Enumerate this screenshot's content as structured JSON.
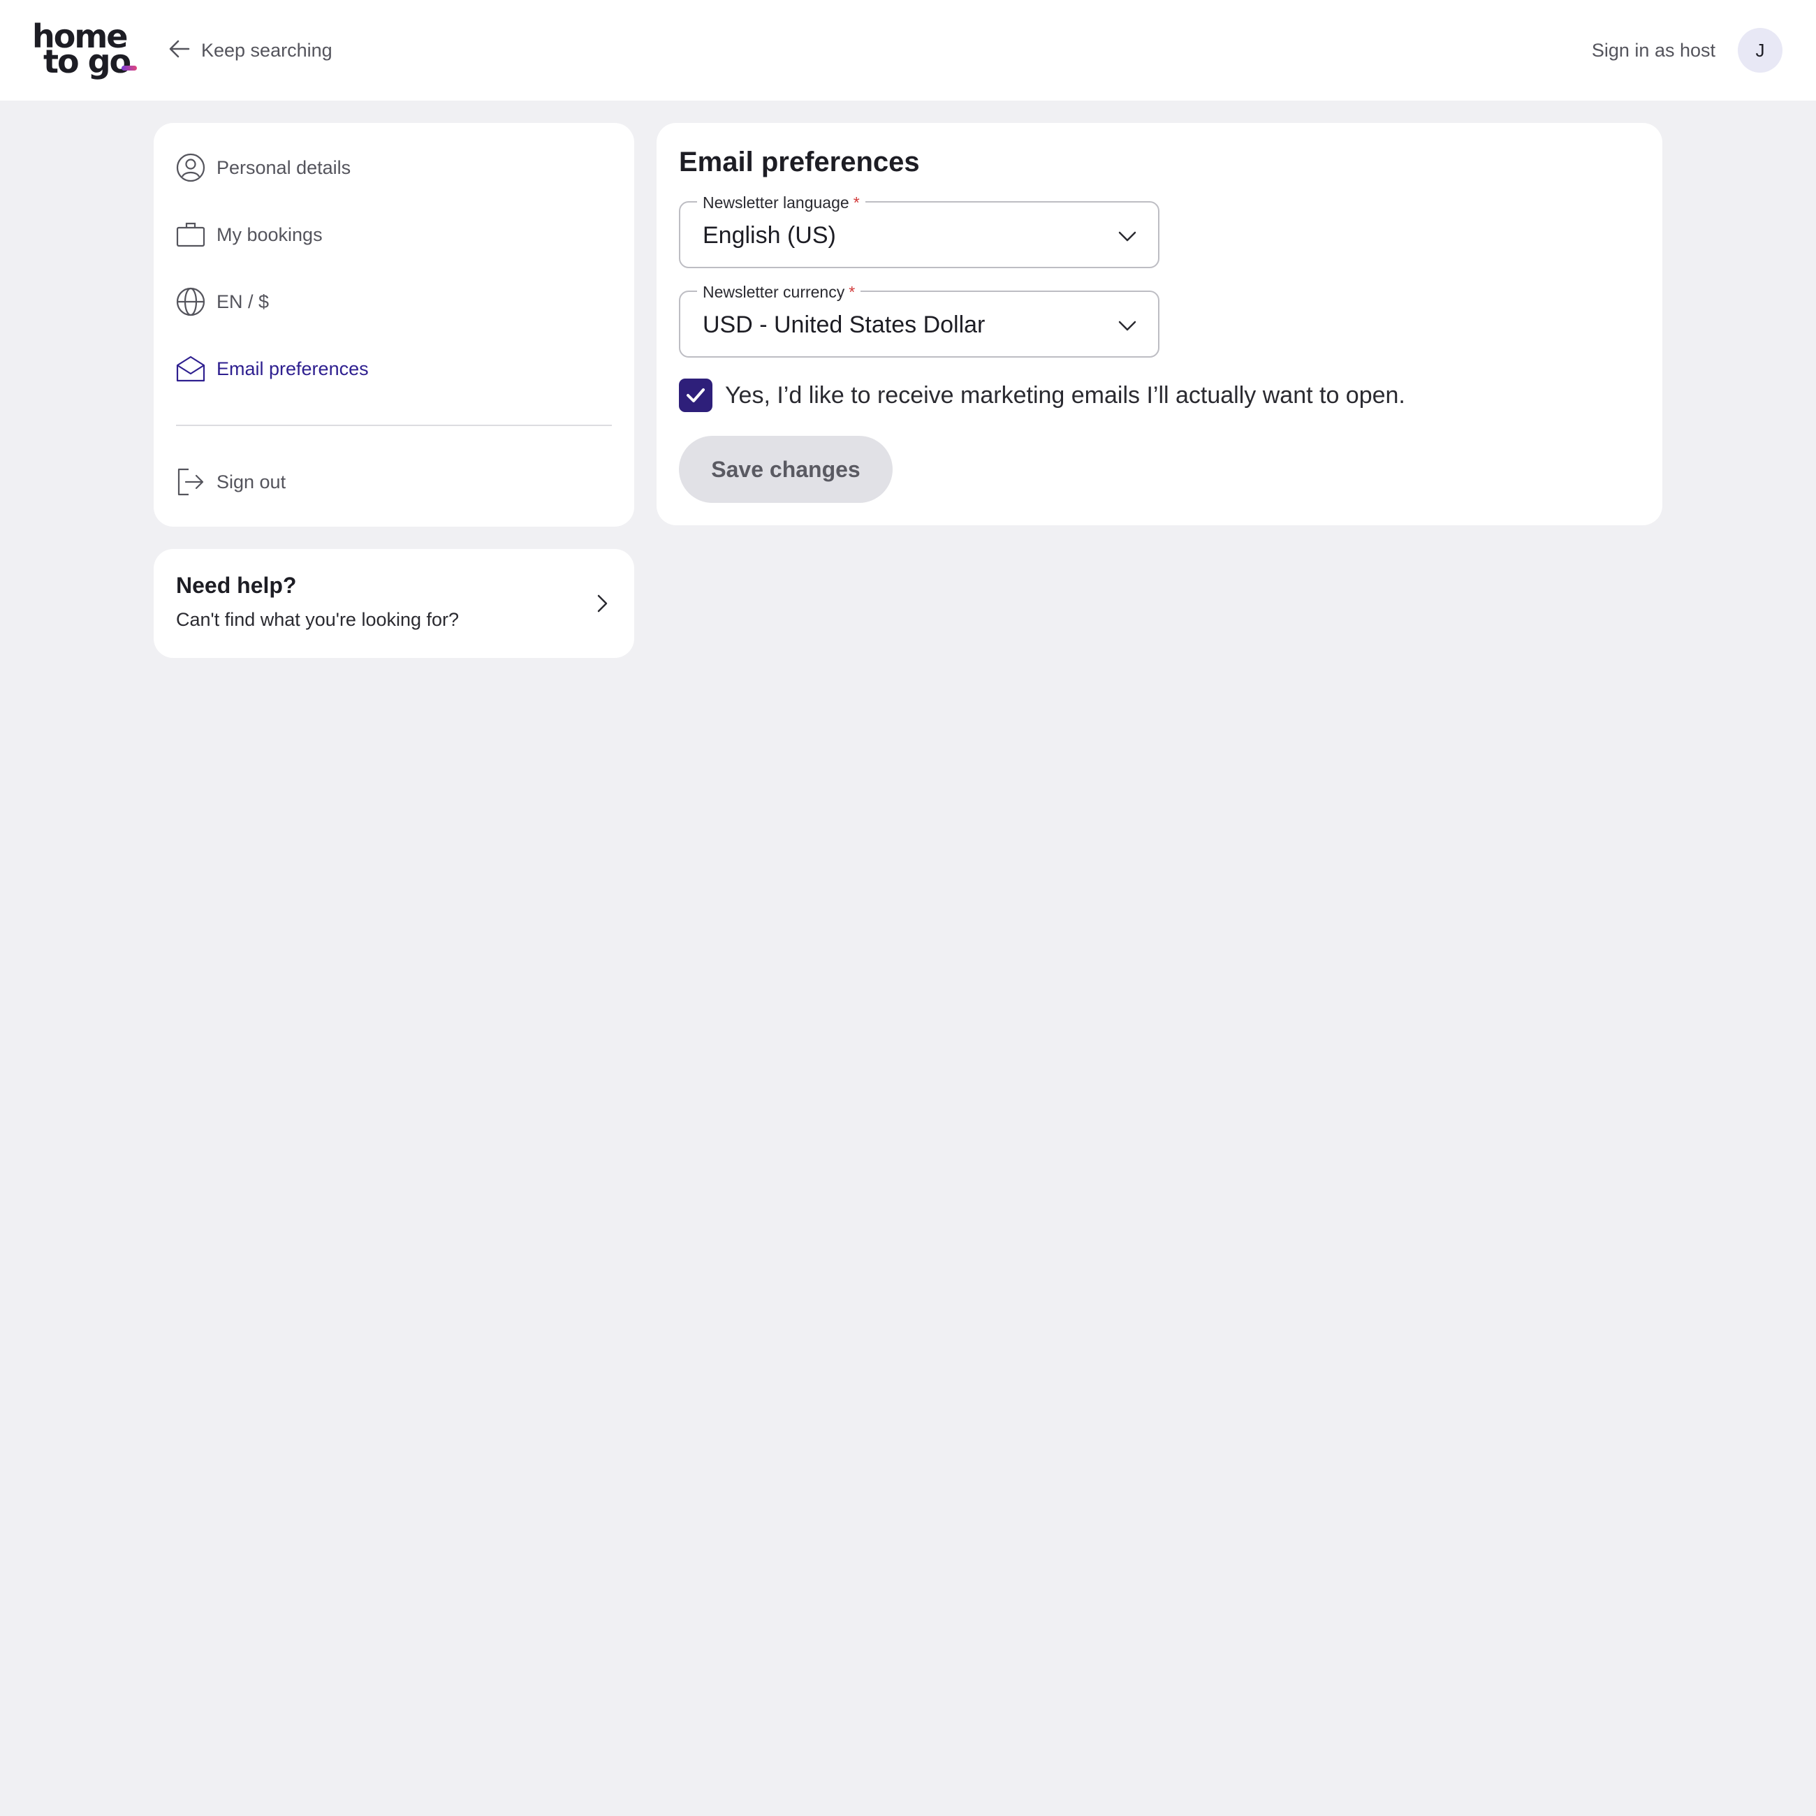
{
  "header": {
    "logo_line1": "home",
    "logo_line2": "to go",
    "back_label": "Keep searching",
    "host_label": "Sign in as host",
    "avatar_initial": "J"
  },
  "sidebar": {
    "items": [
      {
        "label": "Personal details",
        "icon": "user-circle-icon"
      },
      {
        "label": "My bookings",
        "icon": "briefcase-icon"
      },
      {
        "label": "EN / $",
        "icon": "globe-icon"
      },
      {
        "label": "Email preferences",
        "icon": "envelope-open-icon",
        "active": true
      }
    ],
    "signout_label": "Sign out"
  },
  "help": {
    "title": "Need help?",
    "subtitle": "Can't find what you're looking for?"
  },
  "main": {
    "title": "Email preferences",
    "language": {
      "label": "Newsletter language",
      "required": "*",
      "value": "English (US)"
    },
    "currency": {
      "label": "Newsletter currency",
      "required": "*",
      "value": "USD - United States Dollar"
    },
    "marketing_checkbox": {
      "checked": true,
      "label": "Yes, I’d like to receive marketing emails I’ll actually want to open."
    },
    "save_label": "Save changes"
  },
  "colors": {
    "accent": "#2e1f8f",
    "checkbox": "#2e1f7a",
    "background": "#f0f0f3",
    "required": "#d23a3a"
  }
}
